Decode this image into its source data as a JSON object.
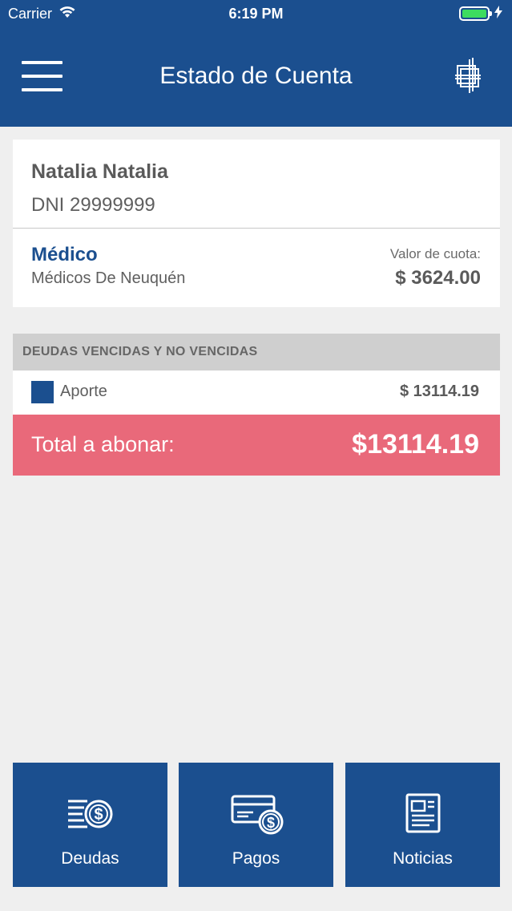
{
  "status_bar": {
    "carrier": "Carrier",
    "time": "6:19 PM",
    "battery_color": "#3ddc5f"
  },
  "header": {
    "title": "Estado de Cuenta",
    "menu_icon": "hamburger-menu-icon",
    "logo_icon": "app-logo-icon",
    "background_color": "#1b4f8f"
  },
  "profile": {
    "name": "Natalia Natalia",
    "dni": "DNI 29999999",
    "plan_title": "Médico",
    "plan_subtitle": "Médicos De Neuquén",
    "fee_label": "Valor de cuota:",
    "fee_value": "$ 3624.00"
  },
  "debts": {
    "section_title": "DEUDAS VENCIDAS Y NO VENCIDAS",
    "items": [
      {
        "label": "Aporte",
        "amount": "$ 13114.19",
        "color": "#1b4f8f"
      }
    ],
    "total_label": "Total a abonar:",
    "total_value": "$13114.19",
    "total_color": "#e9697a"
  },
  "tabs": [
    {
      "label": "Deudas",
      "icon": "debts-money-icon"
    },
    {
      "label": "Pagos",
      "icon": "payments-card-icon"
    },
    {
      "label": "Noticias",
      "icon": "news-newspaper-icon"
    }
  ]
}
